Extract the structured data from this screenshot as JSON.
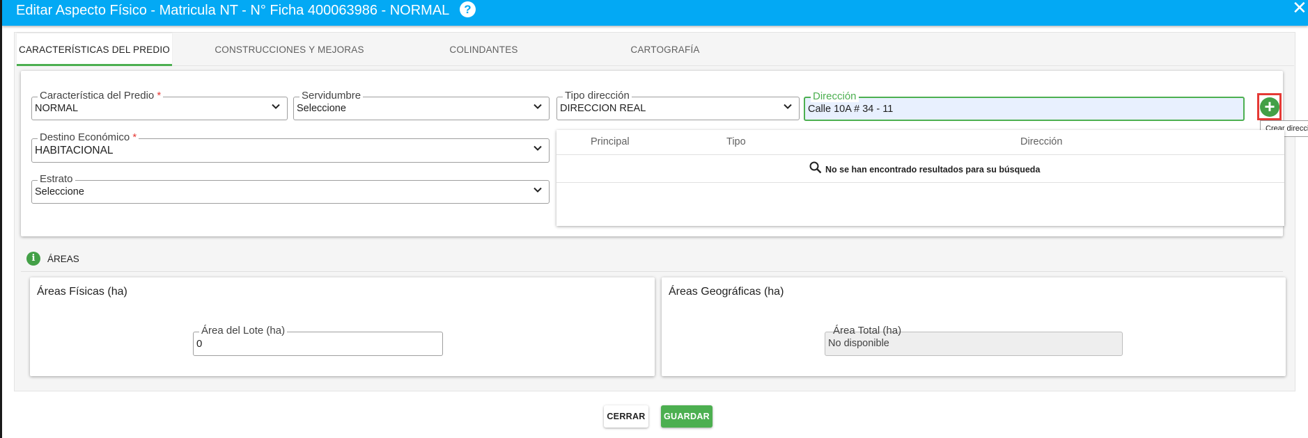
{
  "header": {
    "title": "Editar Aspecto Físico - Matricula NT - N° Ficha 400063986 - NORMAL",
    "help_icon": "?",
    "close_icon": "✕"
  },
  "tabs": [
    {
      "label": "CARACTERÍSTICAS DEL PREDIO",
      "active": true
    },
    {
      "label": "CONSTRUCCIONES Y MEJORAS",
      "active": false
    },
    {
      "label": "COLINDANTES",
      "active": false
    },
    {
      "label": "CARTOGRAFÍA",
      "active": false
    }
  ],
  "predio": {
    "caracteristica": {
      "label": "Característica del Predio",
      "required_mark": "*",
      "value": "NORMAL"
    },
    "servidumbre": {
      "label": "Servidumbre",
      "value": "Seleccione"
    },
    "tipo_direccion": {
      "label": "Tipo dirección",
      "value": "DIRECCION REAL"
    },
    "direccion": {
      "label": "Dirección",
      "value": "Calle 10A # 34 - 11"
    },
    "destino": {
      "label": "Destino Económico",
      "required_mark": "*",
      "value": "HABITACIONAL"
    },
    "estrato": {
      "label": "Estrato",
      "value": "Seleccione"
    }
  },
  "add_button": {
    "icon": "+",
    "tooltip": "Crear dirección"
  },
  "table": {
    "columns": [
      "Principal",
      "Tipo",
      "Dirección"
    ],
    "empty_message": "No se han encontrado resultados para su búsqueda"
  },
  "areas": {
    "section_title": "ÁREAS",
    "info_icon": "i",
    "fisicas": {
      "title": "Áreas Físicas (ha)",
      "lote_label": "Área del Lote (ha)",
      "lote_value": "0"
    },
    "geograficas": {
      "title": "Áreas Geográficas (ha)",
      "total_label": "Área Total (ha)",
      "total_value": "No disponible"
    }
  },
  "buttons": {
    "cerrar": "CERRAR",
    "guardar": "GUARDAR"
  },
  "colors": {
    "header": "#03a9f4",
    "accent_green": "#4caf50",
    "required": "#e53935"
  }
}
